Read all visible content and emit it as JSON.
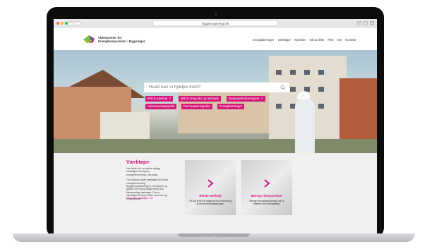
{
  "browser": {
    "url": "byggeriogenergi.dk",
    "traffic_colors": [
      "#ff5f57",
      "#febc2e",
      "#28c840"
    ]
  },
  "site": {
    "logo_text_line1": "Videncenter for",
    "logo_text_line2": "Energibesparelser i Bygninger",
    "nav": [
      "Energiløsninger",
      "Værktøjer",
      "Nyheder",
      "Info & links",
      "Film",
      "Om",
      "Kontakt"
    ]
  },
  "hero": {
    "search_placeholder": "Hvad kan vi hjælpe med?",
    "tags": [
      "BR18-værktøj ↗",
      "BR18 lovguide og faktaark",
      "Besparelsesberegner ↗",
      "Varmepumpeguide",
      "Dampspærreguide",
      "Energiløsninger"
    ]
  },
  "tools": {
    "title": "Værktøjer",
    "intro": "Her finder du en række nyttige værktøjer til at spare energi/renovering i din bolig.",
    "body": "Find blandt andet værktøjer til at lave energirenovering, byggeprojektberegner, beregnere og guider om energi rådgivning med klimavenlige løsninger. Der er værktøjer til brug i både erhvervs og boligprojekter.",
    "link": "Find alle værktøjer her",
    "cards": [
      {
        "title": "BR18-værktøj",
        "subtitle": "Få dig til BR18-reglerne ved renovering af erhvervs/ejerbygninger."
      },
      {
        "title": "Beregn besparelser",
        "subtitle": "Beregn energibesparelsen og se effekten af et energitiltag."
      }
    ]
  },
  "device": {
    "brand": "MacBook"
  },
  "colors": {
    "accent": "#d3167a",
    "logo_green": "#7cc04a",
    "logo_purple": "#8a3a8f",
    "logo_yellow": "#f4c41d"
  }
}
